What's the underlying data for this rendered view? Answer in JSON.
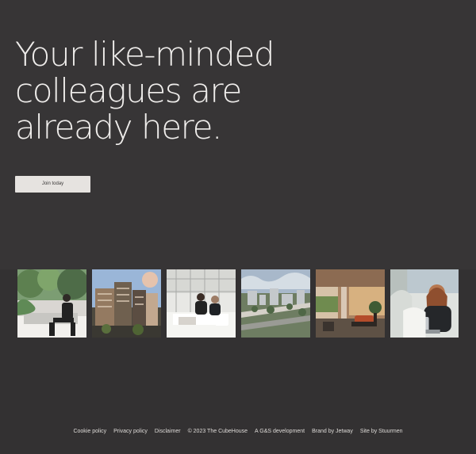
{
  "hero": {
    "title_lines": [
      "Your like-minded",
      "colleagues are",
      "already here."
    ],
    "cta_label": "Join today"
  },
  "gallery": {
    "items": [
      {
        "icon": "garden-person-photo"
      },
      {
        "icon": "building-exterior-photo"
      },
      {
        "icon": "office-meeting-photo"
      },
      {
        "icon": "city-aerial-photo"
      },
      {
        "icon": "lounge-interior-photo"
      },
      {
        "icon": "woman-laptop-photo"
      }
    ]
  },
  "footer": {
    "links": [
      "Cookie policy",
      "Privacy policy",
      "Disclaimer"
    ],
    "copyright": "© 2023 The CubeHouse",
    "development": "A G&S development",
    "brand_credit": "Brand by Jetway",
    "site_credit": "Site by Stuurmen"
  },
  "colors": {
    "page_background": "#373536",
    "lower_background": "#333132",
    "title_text": "#efedeb",
    "button_background": "#e6e3e0",
    "footer_text": "#dedbd8"
  }
}
